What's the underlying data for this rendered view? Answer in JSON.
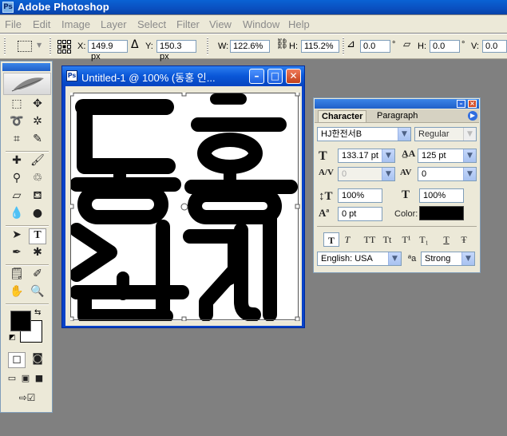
{
  "app": {
    "title": "Adobe Photoshop",
    "icon": "photoshop-icon"
  },
  "menu": [
    "File",
    "Edit",
    "Image",
    "Layer",
    "Select",
    "Filter",
    "View",
    "Window",
    "Help"
  ],
  "options": {
    "x_label": "X:",
    "x_value": "149.9 px",
    "y_label": "Y:",
    "y_value": "150.3 px",
    "w_label": "W:",
    "w_value": "122.6%",
    "h_label": "H:",
    "h_value": "115.2%",
    "angle_value": "0.0",
    "angle_unit": "°",
    "hskew_label": "H:",
    "hskew_value": "0.0",
    "hskew_unit": "°",
    "vskew_label": "V:",
    "vskew_value": "0.0"
  },
  "document": {
    "title": "Untitled-1 @ 100% (동홍 인...",
    "text": "동홍 인..."
  },
  "character_panel": {
    "tabs": [
      "Character",
      "Paragraph"
    ],
    "font_family": "HJ한전서B",
    "font_style": "Regular",
    "font_size": "133.17 pt",
    "leading": "125 pt",
    "kerning": "0",
    "tracking": "0",
    "vertical_scale": "100%",
    "horizontal_scale": "100%",
    "baseline_shift": "0 pt",
    "color_label": "Color:",
    "color": "#000000",
    "style_buttons": [
      "T",
      "T",
      "TT",
      "Tt",
      "T¹",
      "T₁",
      "T",
      "Ŧ"
    ],
    "language": "English: USA",
    "aa_label": "ªa",
    "antialias": "Strong"
  },
  "colors": {
    "titlebar": "#0a4fbf",
    "workspace": "#808080",
    "panel": "#ece9d8",
    "foreground": "#000000",
    "background": "#ffffff"
  }
}
